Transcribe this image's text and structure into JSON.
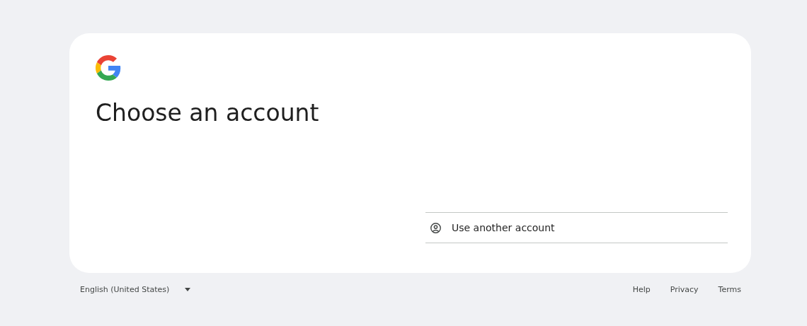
{
  "card": {
    "title": "Choose an account",
    "options": [
      {
        "label": "Use another account"
      }
    ]
  },
  "footer": {
    "language": "English (United States)",
    "links": [
      "Help",
      "Privacy",
      "Terms"
    ]
  }
}
